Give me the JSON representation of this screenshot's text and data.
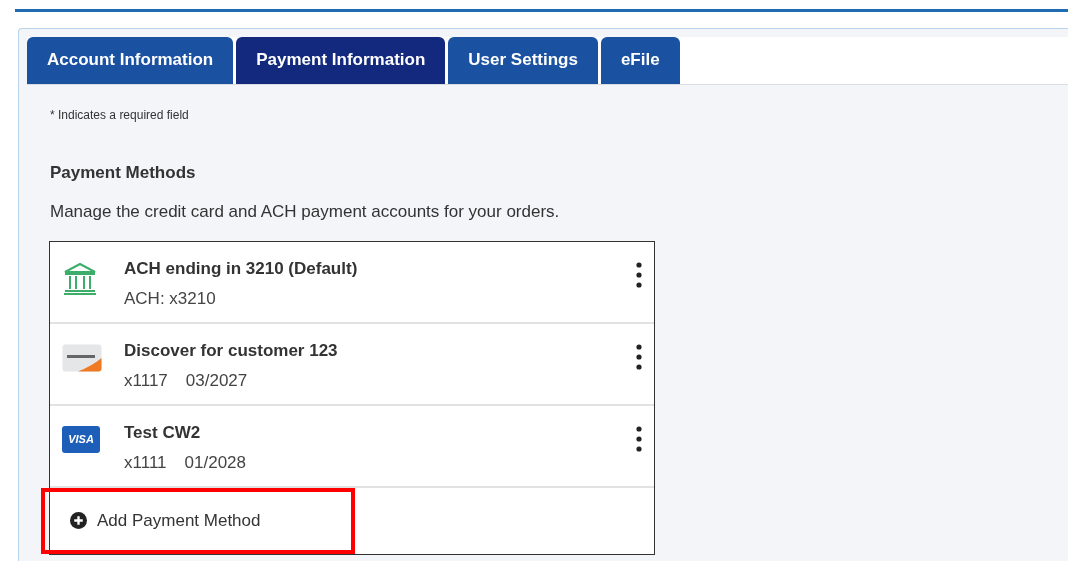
{
  "tabs": [
    {
      "label": "Account Information",
      "selected": false
    },
    {
      "label": "Payment Information",
      "selected": true
    },
    {
      "label": "User Settings",
      "selected": false
    },
    {
      "label": "eFile",
      "selected": false
    }
  ],
  "required_note": "* Indicates a required field",
  "section": {
    "title": "Payment Methods",
    "description": "Manage the credit card and ACH payment accounts for your orders."
  },
  "payment_methods": [
    {
      "kind": "bank",
      "title": "ACH ending in 3210 (Default)",
      "details": [
        "ACH: x3210"
      ]
    },
    {
      "kind": "discover",
      "title": "Discover for customer 123",
      "details": [
        "x1117",
        "03/2027"
      ]
    },
    {
      "kind": "visa",
      "title": "Test CW2",
      "details": [
        "x1111",
        "01/2028"
      ],
      "logo_text": "VISA"
    }
  ],
  "add_action": {
    "label": "Add Payment Method",
    "highlighted": true
  }
}
